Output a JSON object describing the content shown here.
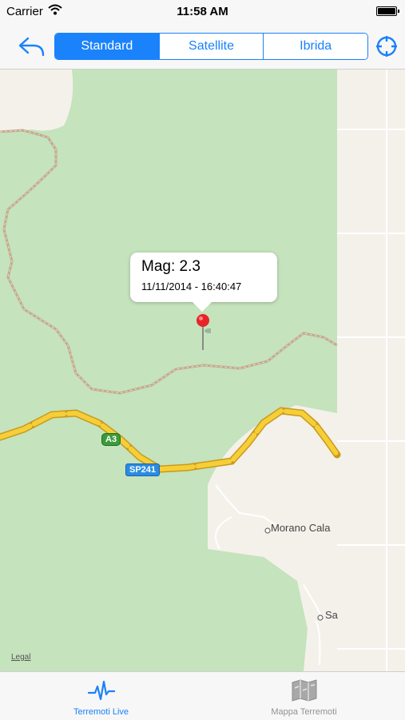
{
  "status_bar": {
    "carrier": "Carrier",
    "time": "11:58 AM"
  },
  "toolbar": {
    "map_types": [
      {
        "label": "Standard",
        "selected": true
      },
      {
        "label": "Satellite",
        "selected": false
      },
      {
        "label": "Ibrida",
        "selected": false
      }
    ],
    "back_icon": "reply-arrow-icon",
    "locate_icon": "location-crosshair-icon"
  },
  "map": {
    "annotation": {
      "title": "Mag: 2.3",
      "subtitle": "11/11/2014 - 16:40:47",
      "pin_color": "#e8242a"
    },
    "road_labels": {
      "a3": "A3",
      "sp241": "SP241"
    },
    "places": {
      "morano": "Morano Cala",
      "sa": "Sa"
    },
    "legal": "Legal"
  },
  "tab_bar": {
    "tabs": [
      {
        "label": "Terremoti Live",
        "icon": "heartbeat-pulse-icon",
        "selected": true
      },
      {
        "label": "Mappa Terremoti",
        "icon": "folded-map-icon",
        "selected": false
      }
    ],
    "accent": "#1a82fb"
  }
}
